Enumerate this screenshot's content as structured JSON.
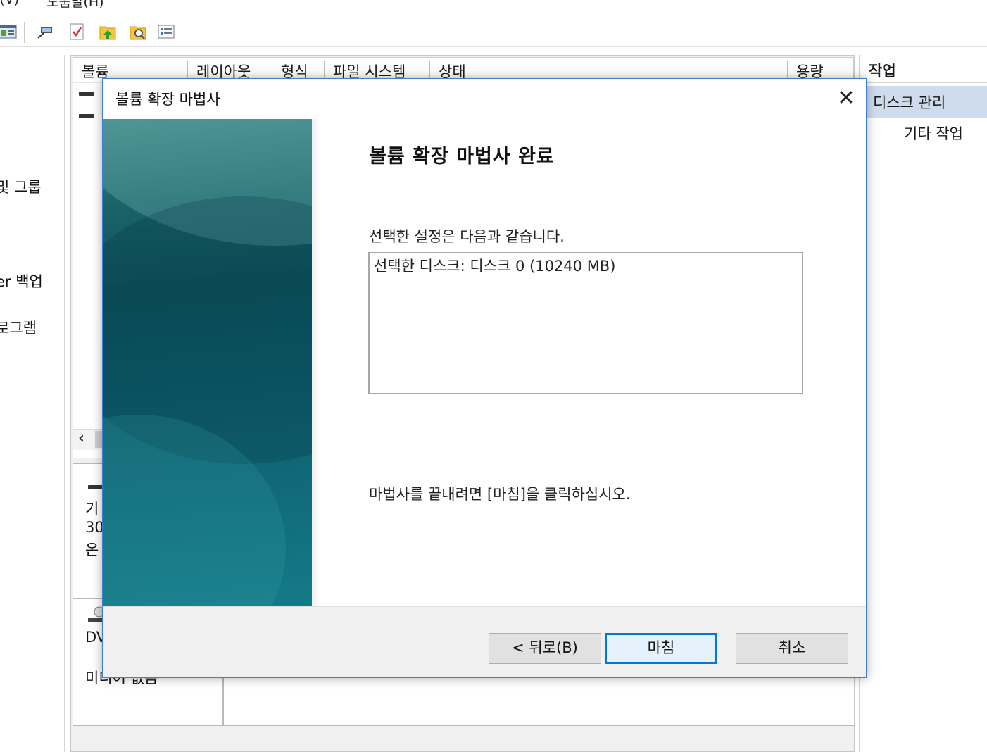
{
  "menubar": {
    "view_menu": "l(V)",
    "help_menu": "도움말(H)"
  },
  "toolbar": {
    "icons": [
      "console-icon",
      "connect-icon",
      "check-icon",
      "up-arrow-icon",
      "search-icon",
      "properties-icon"
    ]
  },
  "left_pane": {
    "items": [
      "및 그룹",
      "er 백업",
      "로그램"
    ]
  },
  "volume_list": {
    "columns": [
      "볼륨",
      "레이아웃",
      "형식",
      "파일 시스템",
      "상태",
      "용량"
    ]
  },
  "disk_map": {
    "disk0_label_lines": [
      "기",
      "30",
      "온"
    ],
    "dvd_label": "DV",
    "dvd_media": "미디어 없음"
  },
  "actions_pane": {
    "title": "작업",
    "selected": "디스크 관리",
    "other": "기타 작업"
  },
  "dialog": {
    "title": "볼륨 확장 마법사",
    "close_glyph": "✕",
    "heading": "볼륨 확장 마법사 완료",
    "intro": "선택한 설정은 다음과 같습니다.",
    "summary": "선택한 디스크: 디스크 0 (10240 MB)",
    "finish_hint": "마법사를 끝내려면 [마침]을 클릭하십시오.",
    "buttons": {
      "back": "< 뒤로(B)",
      "finish": "마침",
      "cancel": "취소"
    }
  },
  "colors": {
    "dialog_border": "#3d7fd0",
    "default_button_border": "#0078d7",
    "actions_selected_bg": "#cfdcee",
    "wizard_art_teal": "#0d525d"
  }
}
